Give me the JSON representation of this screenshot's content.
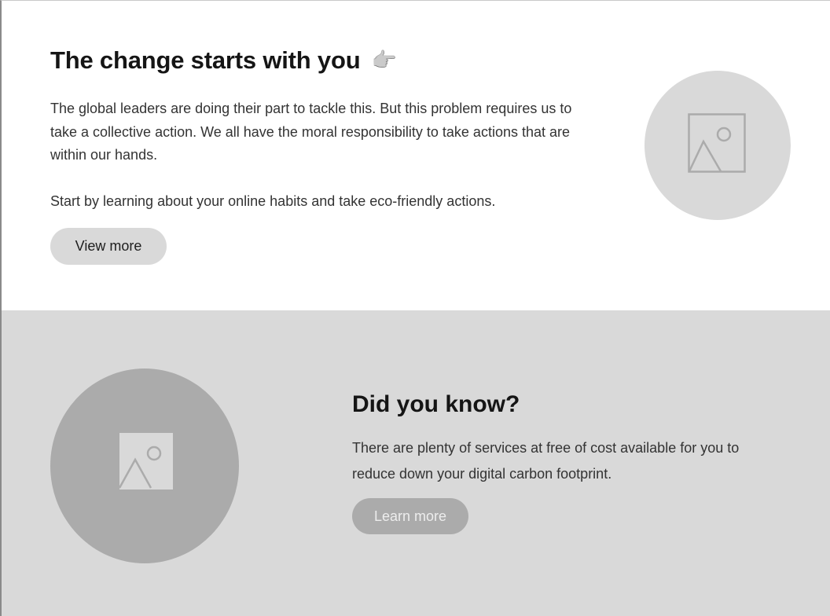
{
  "hero": {
    "title": "The change starts with you",
    "title_emoji": "👉",
    "body_line_1": "The global leaders are doing their part to tackle this. But this problem requires us to take a collective action. We all have the moral responsibility to take actions that are within our hands.",
    "body_line_2": "Start by learning about your online habits and take eco-friendly actions.",
    "button_label": "View more",
    "image_icon": "image-placeholder-icon"
  },
  "did_you_know": {
    "title": "Did you know?",
    "body": "There are plenty of services at free of cost available for you to reduce down your digital carbon footprint.",
    "button_label": "Learn more",
    "image_icon": "image-placeholder-icon"
  },
  "colors": {
    "section_two_background": "#d9d9d9",
    "placeholder_light": "#d9d9d9",
    "placeholder_dark": "#ababab",
    "button_primary": "#d9d9d9",
    "button_disabled": "#ababab"
  }
}
